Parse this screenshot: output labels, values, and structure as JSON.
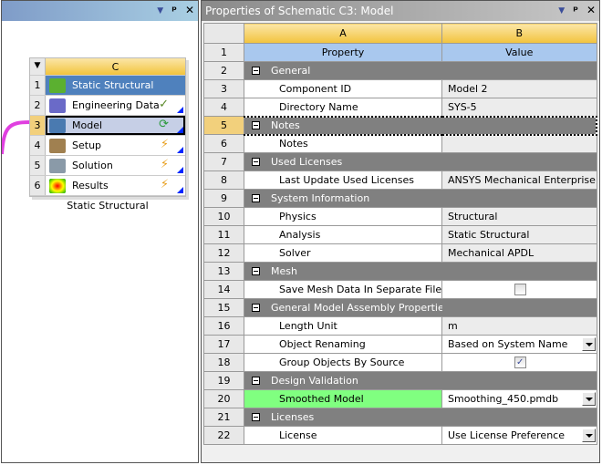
{
  "left_panel": {
    "system": {
      "column": "C",
      "name": "Static Structural",
      "rows": [
        {
          "num": "1",
          "label": "Static Structural",
          "icon": "static-structural-icon",
          "status": ""
        },
        {
          "num": "2",
          "label": "Engineering Data",
          "icon": "book-icon",
          "status": "✓"
        },
        {
          "num": "3",
          "label": "Model",
          "icon": "model-icon",
          "status": "⟳"
        },
        {
          "num": "4",
          "label": "Setup",
          "icon": "setup-icon",
          "status": "⚡"
        },
        {
          "num": "5",
          "label": "Solution",
          "icon": "solution-icon",
          "status": "⚡"
        },
        {
          "num": "6",
          "label": "Results",
          "icon": "results-icon",
          "status": "⚡"
        }
      ]
    }
  },
  "properties": {
    "title": "Properties of Schematic C3: Model",
    "col_a": "A",
    "col_b": "B",
    "header": {
      "num": "1",
      "property": "Property",
      "value": "Value"
    },
    "rows": [
      {
        "num": "2",
        "group": "General"
      },
      {
        "num": "3",
        "property": "Component ID",
        "value": "Model 2"
      },
      {
        "num": "4",
        "property": "Directory Name",
        "value": "SYS-5"
      },
      {
        "num": "5",
        "group": "Notes"
      },
      {
        "num": "6",
        "property": "Notes",
        "value": ""
      },
      {
        "num": "7",
        "group": "Used Licenses"
      },
      {
        "num": "8",
        "property": "Last Update Used Licenses",
        "value": "ANSYS Mechanical Enterprise"
      },
      {
        "num": "9",
        "group": "System Information"
      },
      {
        "num": "10",
        "property": "Physics",
        "value": "Structural"
      },
      {
        "num": "11",
        "property": "Analysis",
        "value": "Static Structural"
      },
      {
        "num": "12",
        "property": "Solver",
        "value": "Mechanical APDL"
      },
      {
        "num": "13",
        "group": "Mesh"
      },
      {
        "num": "14",
        "property": "Save Mesh Data In Separate File",
        "checked": false
      },
      {
        "num": "15",
        "group": "General Model Assembly Properties"
      },
      {
        "num": "16",
        "property": "Length Unit",
        "value": "m"
      },
      {
        "num": "17",
        "property": "Object Renaming",
        "value": "Based on System Name"
      },
      {
        "num": "18",
        "property": "Group Objects By Source",
        "checked": true
      },
      {
        "num": "19",
        "group": "Design Validation"
      },
      {
        "num": "20",
        "property": "Smoothed Model",
        "value": "Smoothing_450.pmdb"
      },
      {
        "num": "21",
        "group": "Licenses"
      },
      {
        "num": "22",
        "property": "License",
        "value": "Use License Preference"
      }
    ]
  }
}
